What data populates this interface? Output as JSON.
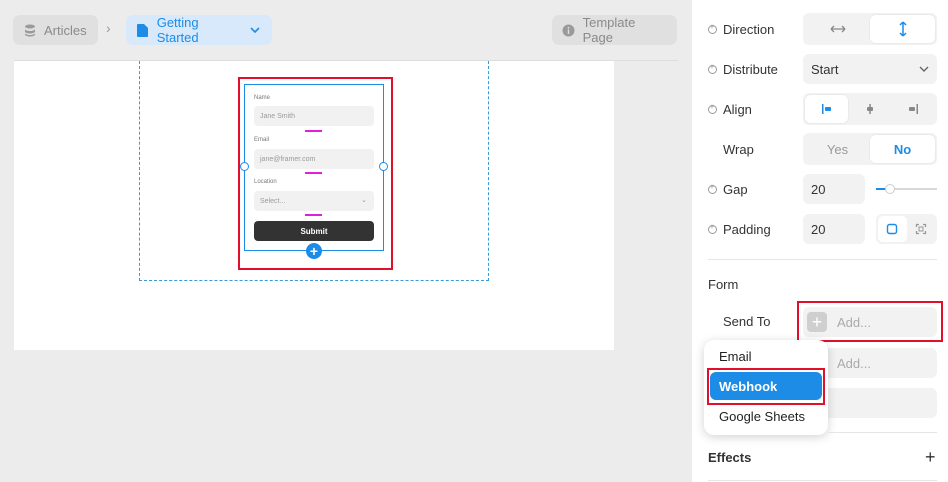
{
  "breadcrumb": {
    "articles_label": "Articles",
    "current_label": "Getting Started",
    "separator": "›",
    "template_label": "Template Page"
  },
  "form_preview": {
    "name_label": "Name",
    "name_placeholder": "Jane Smith",
    "email_label": "Email",
    "email_placeholder": "jane@framer.com",
    "location_label": "Location",
    "location_placeholder": "Select...",
    "submit_label": "Submit"
  },
  "properties": {
    "direction_label": "Direction",
    "distribute_label": "Distribute",
    "distribute_value": "Start",
    "align_label": "Align",
    "wrap_label": "Wrap",
    "wrap_options": [
      "Yes",
      "No"
    ],
    "gap_label": "Gap",
    "gap_value": "20",
    "padding_label": "Padding",
    "padding_value": "20"
  },
  "form_section": {
    "title": "Form",
    "send_to_label": "Send To",
    "add_placeholder": "Add...",
    "add_placeholder_2": "Add..."
  },
  "dropdown": {
    "items": [
      "Email",
      "Webhook",
      "Google Sheets"
    ],
    "selected": "Webhook"
  },
  "effects": {
    "title": "Effects",
    "add": "+"
  },
  "colors": {
    "accent": "#1c8ce6",
    "highlight": "#e0102a",
    "gap_marker": "#e01ee0"
  }
}
